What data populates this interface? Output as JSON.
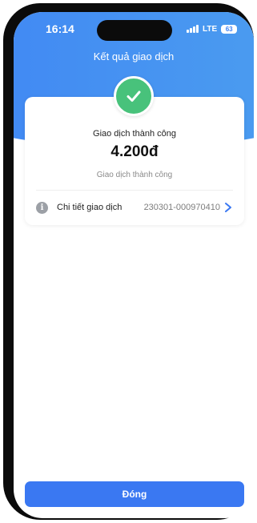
{
  "status_bar": {
    "time": "16:14",
    "network": "LTE",
    "battery": "63"
  },
  "header": {
    "title": "Kết quả giao dịch"
  },
  "result": {
    "icon": "check-icon",
    "title": "Giao dịch thành công",
    "amount": "4.200đ",
    "subtitle": "Giao dịch thành công"
  },
  "detail": {
    "label": "Chi tiết giao dịch",
    "transaction_id": "230301-000970410",
    "icon": "info-icon"
  },
  "footer": {
    "close_label": "Đóng"
  },
  "colors": {
    "primary": "#3a78f2",
    "success": "#48c27b",
    "header_gradient_start": "#3e82f5",
    "header_gradient_end": "#4ea3ee"
  }
}
